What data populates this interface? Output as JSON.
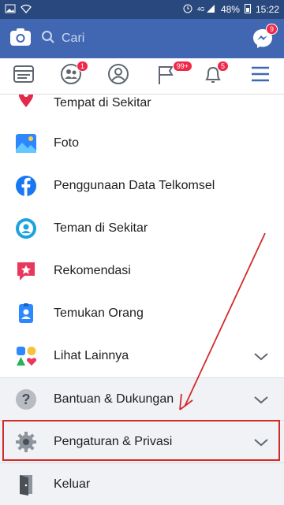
{
  "status": {
    "battery": "48%",
    "time": "15:22"
  },
  "search": {
    "placeholder": "Cari"
  },
  "messenger_badge": "9",
  "tabs_badges": {
    "friends": "1",
    "pages": "99+",
    "notifications": "5"
  },
  "menu": [
    {
      "label": "Tempat di Sekitar",
      "icon": "location-pin-icon"
    },
    {
      "label": "Foto",
      "icon": "photo-icon"
    },
    {
      "label": "Penggunaan Data Telkomsel",
      "icon": "facebook-icon"
    },
    {
      "label": "Teman di Sekitar",
      "icon": "nearby-friends-icon"
    },
    {
      "label": "Rekomendasi",
      "icon": "recommendation-icon"
    },
    {
      "label": "Temukan Orang",
      "icon": "find-people-icon"
    },
    {
      "label": "Lihat Lainnya",
      "icon": "see-more-icon"
    },
    {
      "label": "Bantuan & Dukungan",
      "icon": "help-icon"
    },
    {
      "label": "Pengaturan & Privasi",
      "icon": "settings-gear-icon"
    },
    {
      "label": "Keluar",
      "icon": "logout-door-icon"
    }
  ]
}
